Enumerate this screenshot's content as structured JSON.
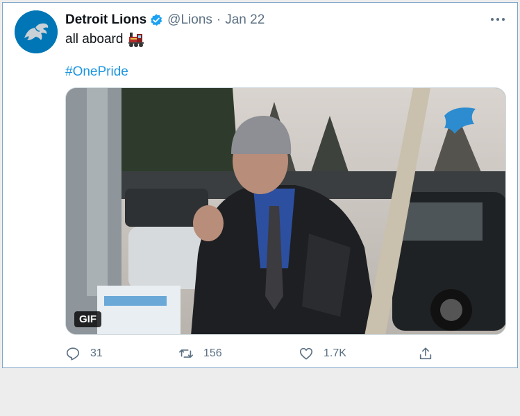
{
  "tweet": {
    "author_name": "Detroit Lions",
    "handle": "@Lions",
    "separator": "·",
    "date": "Jan 22",
    "text": "all aboard",
    "hashtag": "#OnePride",
    "media_badge": "GIF"
  },
  "actions": {
    "replies": "31",
    "retweets": "156",
    "likes": "1.7K"
  },
  "icons": {
    "avatar": "lions-logo",
    "verified": "verified-badge-icon",
    "emoji": "locomotive-emoji",
    "more": "more-icon",
    "reply": "reply-icon",
    "retweet": "retweet-icon",
    "like": "heart-icon",
    "share": "share-icon"
  },
  "colors": {
    "link": "#1b95e0",
    "verified": "#1da1f2",
    "brand": "#0076b6",
    "muted": "#5b7083"
  }
}
